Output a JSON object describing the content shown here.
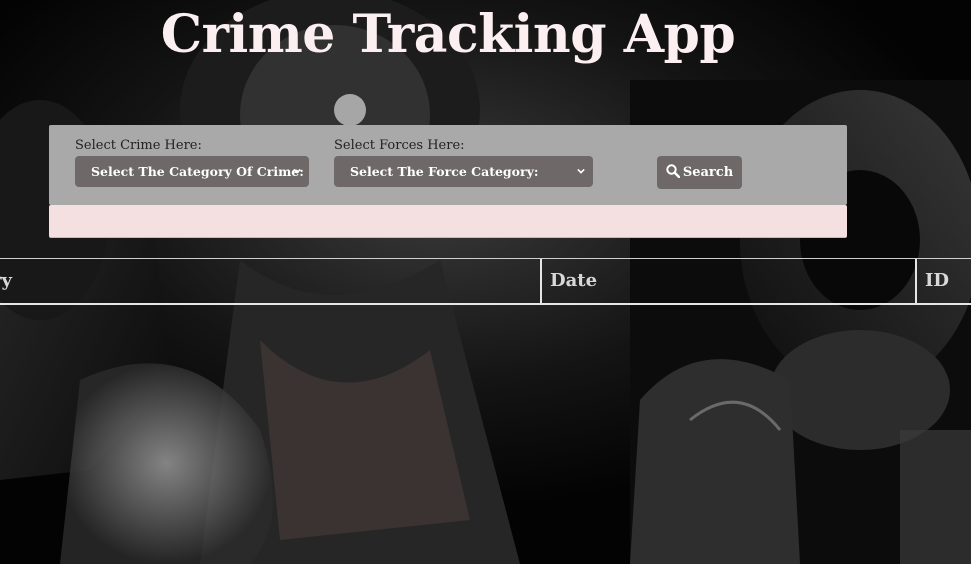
{
  "app": {
    "title": "Crime Tracking App"
  },
  "filters": {
    "crime": {
      "label": "Select Crime Here:",
      "selected": "Select The Category Of Crime:"
    },
    "force": {
      "label": "Select Forces Here:",
      "selected": "Select The Force Category:"
    },
    "search_button": {
      "label": "Search",
      "icon": "search-icon"
    }
  },
  "table": {
    "columns": [
      "ry",
      "Date",
      "ID"
    ]
  },
  "colors": {
    "title": "#fbeff1",
    "panel": "#a9a9a9",
    "control": "#6e6868",
    "alert": "#f4dfe1"
  }
}
